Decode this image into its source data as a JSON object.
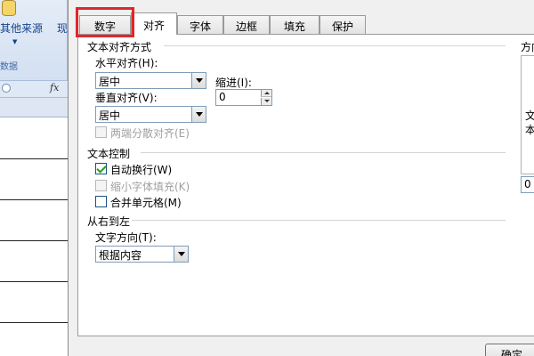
{
  "background": {
    "other_sources_label": "其他来源",
    "now_label": "现",
    "group_label": "数据",
    "fx_label": "fx"
  },
  "dialog": {
    "tabs": [
      {
        "label": "数字",
        "active": false,
        "highlighted": true
      },
      {
        "label": "对齐",
        "active": true
      },
      {
        "label": "字体"
      },
      {
        "label": "边框"
      },
      {
        "label": "填充"
      },
      {
        "label": "保护"
      }
    ],
    "text_alignment": {
      "section_title": "文本对齐方式",
      "horizontal_label": "水平对齐(H):",
      "horizontal_value": "居中",
      "indent_label": "缩进(I):",
      "indent_value": "0",
      "vertical_label": "垂直对齐(V):",
      "vertical_value": "居中",
      "distributed_label": "两端分散对齐(E)"
    },
    "text_control": {
      "section_title": "文本控制",
      "wrap_text_label": "自动换行(W)",
      "wrap_text_checked": true,
      "shrink_to_fit_label": "缩小字体填充(K)",
      "merge_cells_label": "合并单元格(M)"
    },
    "rtl": {
      "section_title": "从右到左",
      "direction_label": "文字方向(T):",
      "direction_value": "根据内容"
    },
    "orientation": {
      "title_partial": "方向",
      "text_partial_1": "文",
      "text_partial_2": "本",
      "degrees_partial": "0"
    },
    "ok_label": "确定"
  },
  "colors": {
    "highlight_border": "#e0262a",
    "checkmark": "#21a121",
    "dialog_bg": "#f0f0f0"
  }
}
